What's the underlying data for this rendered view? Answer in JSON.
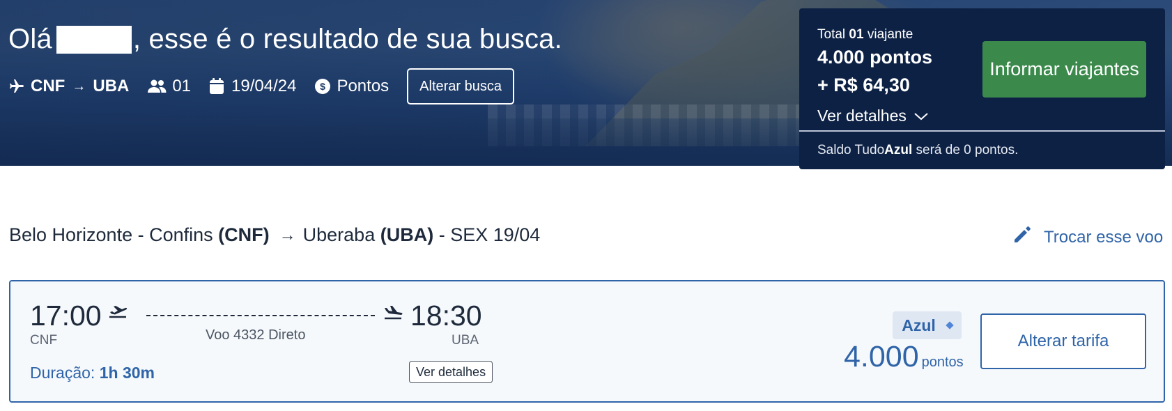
{
  "hero": {
    "greeting_prefix": "Olá",
    "greeting_suffix": ", esse é o resultado de sua busca.",
    "route_origin": "CNF",
    "route_arrow": "→",
    "route_destination": "UBA",
    "passengers": "01",
    "date": "19/04/24",
    "fare_type": "Pontos",
    "change_search_label": "Alterar busca"
  },
  "summary": {
    "total_prefix": "Total",
    "total_count": "01",
    "total_suffix": "viajante",
    "points": "4.000 pontos",
    "money": "+ R$ 64,30",
    "details_label": "Ver detalhes",
    "cta_label": "Informar viajantes",
    "saldo_prefix": "Saldo Tudo",
    "saldo_brand": "Azul",
    "saldo_suffix": "será de 0 pontos."
  },
  "route_title": {
    "origin_city": "Belo Horizonte - Confins",
    "origin_code": "(CNF)",
    "arrow": "→",
    "destination_city": "Uberaba",
    "destination_code": "(UBA)",
    "date": "- SEX 19/04",
    "change_flight_label": "Trocar esse voo"
  },
  "flight": {
    "departure_time": "17:00",
    "departure_code": "CNF",
    "arrival_time": "18:30",
    "arrival_code": "UBA",
    "flight_info": "Voo 4332 Direto",
    "duration_label": "Duração:",
    "duration_value": "1h 30m",
    "details_label": "Ver detalhes",
    "fare_badge": "Azul",
    "price": "4.000",
    "price_unit": "pontos",
    "change_fare_label": "Alterar tarifa"
  },
  "colors": {
    "brand_blue": "#2f64a8",
    "panel_navy": "#0d2145",
    "cta_green": "#3b8a4c"
  },
  "icons": {
    "route": "plane-icon",
    "passengers": "people-icon",
    "date": "calendar-icon",
    "fare_type": "dollar-circle-icon",
    "details": "chevron-down-icon",
    "change_flight": "pencil-icon",
    "departure": "takeoff-icon",
    "arrival": "landing-icon"
  }
}
